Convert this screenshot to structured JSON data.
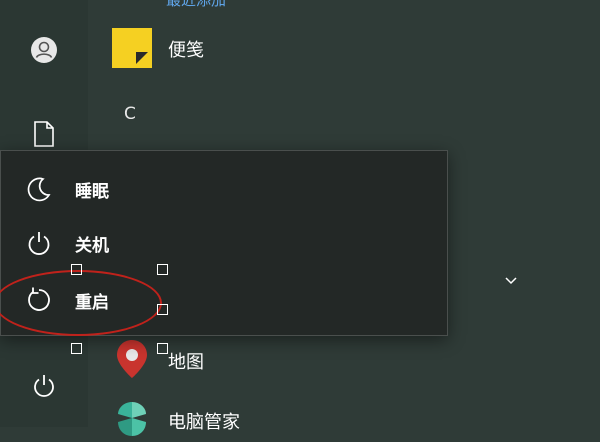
{
  "start_menu": {
    "group_header_top": "最近添加",
    "group_letter": "C",
    "tiles": [
      {
        "label": "便笺",
        "icon": "sticky-notes-icon"
      },
      {
        "label": "地图",
        "icon": "maps-pin-icon"
      },
      {
        "label": "电脑管家",
        "icon": "pc-manager-icon"
      }
    ]
  },
  "left_rail": {
    "icons": [
      "user-avatar-icon",
      "document-icon",
      "power-icon"
    ]
  },
  "power_menu": {
    "items": [
      {
        "label": "睡眠",
        "icon": "moon-icon"
      },
      {
        "label": "关机",
        "icon": "power-icon"
      },
      {
        "label": "重启",
        "icon": "restart-icon"
      }
    ]
  },
  "colors": {
    "background": "#2f3b37",
    "menu_bg": "#232826",
    "annotation_red": "#c0221b",
    "link_blue": "#5fa4e8",
    "sticky_yellow": "#f5d022",
    "maps_red": "#c9342e",
    "pc_manager_teal": "#3ab39a"
  }
}
